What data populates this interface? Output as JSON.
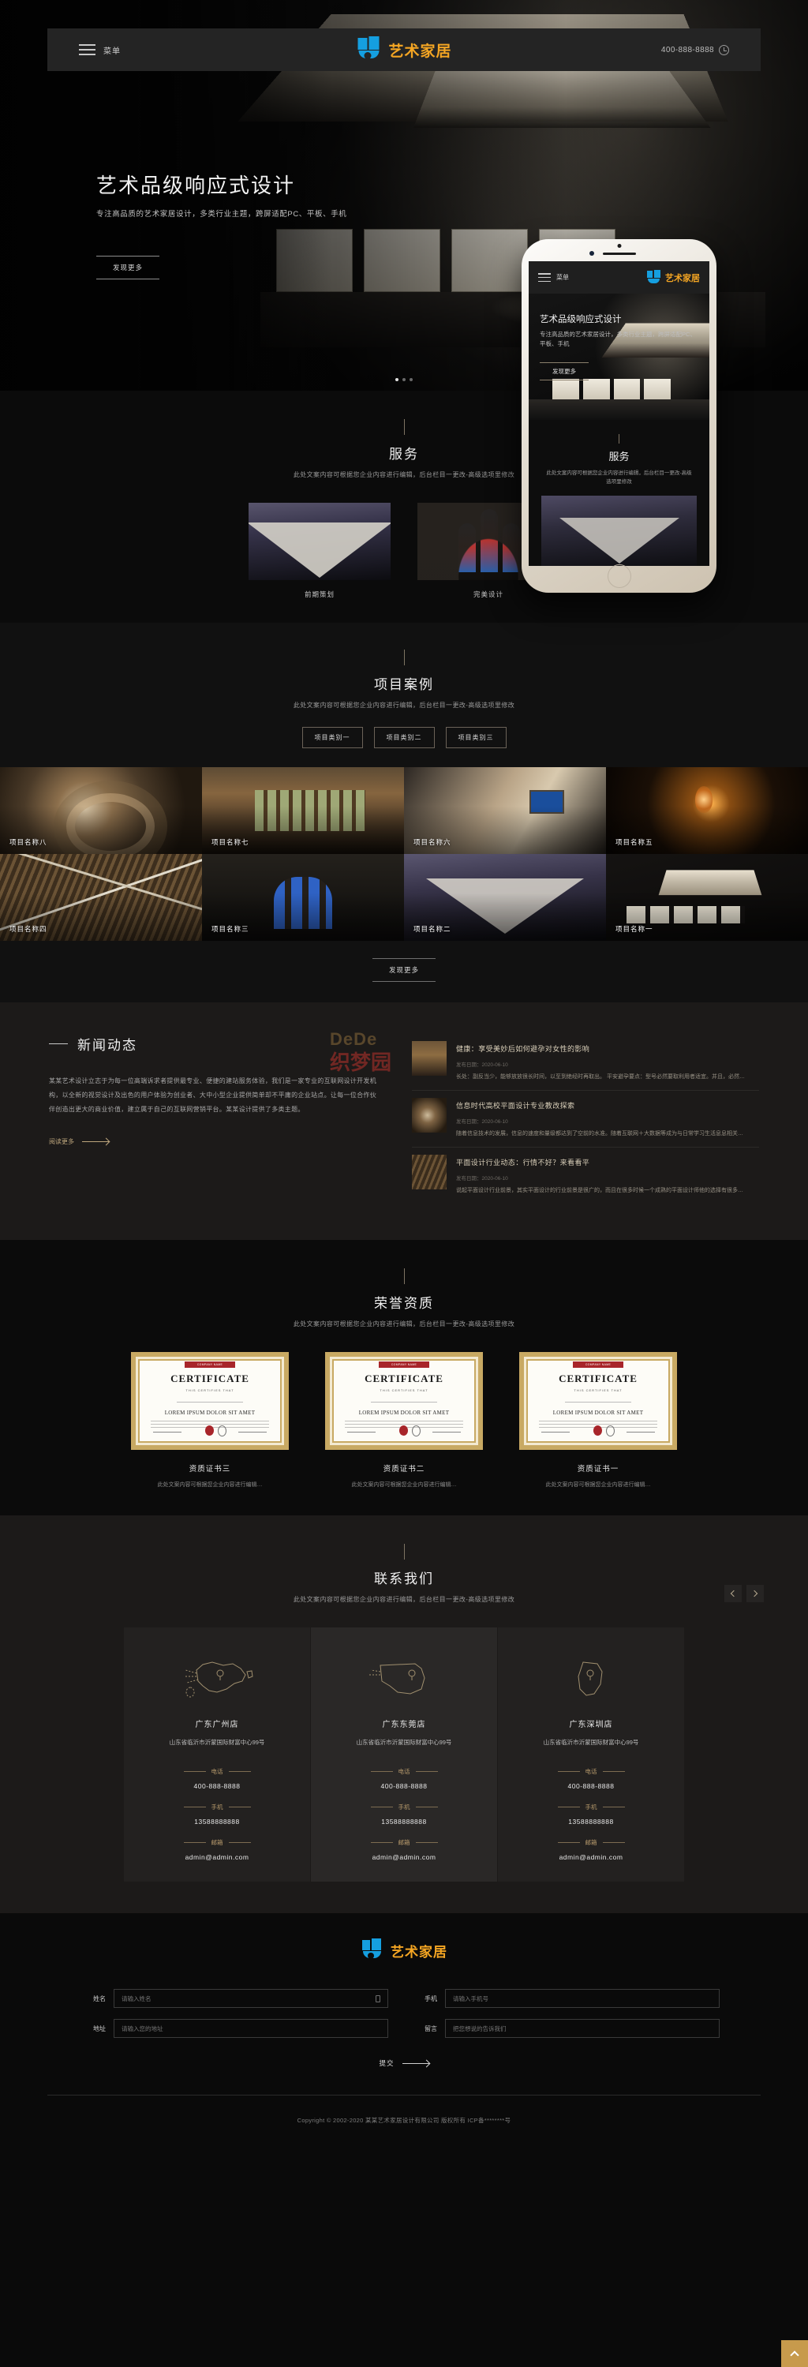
{
  "header": {
    "menu_label": "菜单",
    "brand": "艺术家居",
    "phone": "400-888-8888"
  },
  "hero": {
    "title": "艺术品级响应式设计",
    "subtitle": "专注高品质的艺术家居设计，多类行业主题，跨屏适配PC、平板、手机",
    "cta": "发现更多"
  },
  "phone_mock": {
    "menu_label": "菜单",
    "brand": "艺术家居",
    "title": "艺术品级响应式设计",
    "subtitle": "专注高品质的艺术家居设计，多类行业主题，跨屏适配PC、平板、手机",
    "cta": "发现更多",
    "service_title": "服务",
    "service_sub": "此处文案内容可根据您企业内容进行编辑，后台栏目一更改-高级选项里修改"
  },
  "service": {
    "title": "服务",
    "subtitle": "此处文案内容可根据您企业内容进行编辑，后台栏目一更改-高级选项里修改",
    "cards": [
      {
        "caption": "前期策划"
      },
      {
        "caption": "完美设计"
      }
    ]
  },
  "projects": {
    "title": "项目案例",
    "subtitle": "此处文案内容可根据您企业内容进行编辑，后台栏目一更改-高级选项里修改",
    "tabs": [
      "项目类别一",
      "项目类别二",
      "项目类别三"
    ],
    "items": [
      {
        "label": "项目名称八"
      },
      {
        "label": "项目名称七"
      },
      {
        "label": "项目名称六"
      },
      {
        "label": "项目名称五"
      },
      {
        "label": "项目名称四"
      },
      {
        "label": "项目名称三"
      },
      {
        "label": "项目名称二"
      },
      {
        "label": "项目名称一"
      }
    ],
    "more": "发现更多"
  },
  "news": {
    "title": "新闻动态",
    "body": "某某艺术设计立志于为每一位高端诉求者提供最专业、便捷的建站服务体验，我们是一家专业的互联网设计开发机构，以全新的视觉设计及出色的用户体验为创业者、大中小型企业提供简单却不平庸的企业站点。让每一位合作伙伴创造出更大的商业价值，建立属于自己的互联网营销平台。某某设计提供了多类主题。",
    "read_more": "阅读更多",
    "watermark_1": "DeDe",
    "watermark_2": "织梦园",
    "items": [
      {
        "title": "健康：享受美妙后如何避孕对女性的影响",
        "date": "发布日期：2020-06-10",
        "desc": "长处：副反当少，能够放放很长时间，以至到绝经时再取出。 平安避孕要点：型号必然要取利用者适宜。并且，必然…"
      },
      {
        "title": "信息时代高校平面设计专业教改探索",
        "date": "发布日期：2020-06-10",
        "desc": "随着信息技术的发展，信息的速度和量级都达到了空前的水准。随着互联网＋大数据等成为与日常学习生活息息相关…"
      },
      {
        "title": "平面设计行业动态：行情不好？来看看平",
        "date": "发布日期：2020-06-10",
        "desc": "说起平面设计行业前景，其实平面设计的行业前景是很广的，而且在很多时候一个成熟的平面设计师他的选择有很多…"
      }
    ]
  },
  "honor": {
    "title": "荣誉资质",
    "subtitle": "此处文案内容可根据您企业内容进行编辑，后台栏目一更改-高级选项里修改",
    "cert_ribbon": "COMPANY NAME",
    "cert_heading": "CERTIFICATE",
    "cert_sub": "THIS CERTIFIES THAT",
    "cert_lorem": "LOREM IPSUM DOLOR SIT AMET",
    "items": [
      {
        "name": "资质证书三",
        "desc": "此处文案内容可根据您企业内容进行编辑…"
      },
      {
        "name": "资质证书二",
        "desc": "此处文案内容可根据您企业内容进行编辑…"
      },
      {
        "name": "资质证书一",
        "desc": "此处文案内容可根据您企业内容进行编辑…"
      }
    ]
  },
  "contact": {
    "title": "联系我们",
    "subtitle": "此处文案内容可根据您企业内容进行编辑，后台栏目一更改-高级选项里修改",
    "labels": {
      "phone": "电话",
      "mobile": "手机",
      "email": "邮箱"
    },
    "stores": [
      {
        "name": "广东广州店",
        "address": "山东省临沂市沂蒙国际财富中心99号",
        "phone": "400-888-8888",
        "mobile": "13588888888",
        "email": "admin@admin.com"
      },
      {
        "name": "广东东莞店",
        "address": "山东省临沂市沂蒙国际财富中心99号",
        "phone": "400-888-8888",
        "mobile": "13588888888",
        "email": "admin@admin.com"
      },
      {
        "name": "广东深圳店",
        "address": "山东省临沂市沂蒙国际财富中心99号",
        "phone": "400-888-8888",
        "mobile": "13588888888",
        "email": "admin@admin.com"
      }
    ]
  },
  "footer": {
    "brand": "艺术家居",
    "fields": {
      "name_label": "姓名",
      "name_placeholder": "请输入姓名",
      "phone_label": "手机",
      "phone_placeholder": "请输入手机号",
      "address_label": "地址",
      "address_placeholder": "请输入您的地址",
      "message_label": "留言",
      "message_placeholder": "把您想说的告诉我们"
    },
    "submit": "提交",
    "copyright": "Copyright © 2002-2020 某某艺术家居设计有限公司 版权所有 ICP备********号"
  }
}
